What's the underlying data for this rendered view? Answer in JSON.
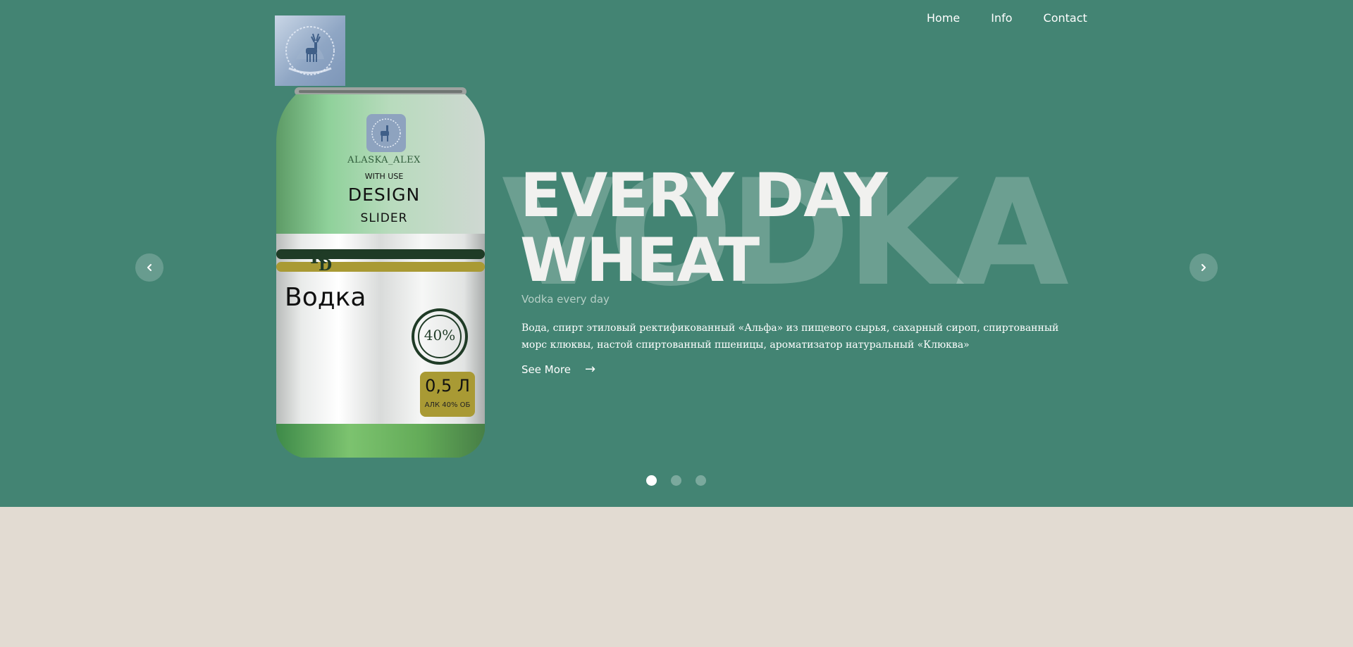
{
  "nav": {
    "items": [
      {
        "label": "Home"
      },
      {
        "label": "Info"
      },
      {
        "label": "Contact"
      }
    ]
  },
  "logo": {
    "alt": "ALASKA ALEX"
  },
  "can": {
    "brand": "ALASKA_ALEX",
    "with_use": "WITH USE",
    "design": "DESIGN",
    "slider": "SLIDER",
    "mark": "KD",
    "product": "Водка",
    "strength": "40%",
    "volume": "0,5 Л",
    "alc": "АЛК 40% ОБ"
  },
  "hero": {
    "watermark": "VODKA",
    "headline_line1": "EVERY DAY",
    "headline_line2": "WHEAT",
    "subtitle": "Vodka every day",
    "description": "Вода, спирт этиловый ректификованный «Альфа» из пищевого сырья, сахарный сироп, спиртованный морс клюквы, настой спиртованный пшеницы, ароматизатор натуральный «Клюква»",
    "see_more": "See More",
    "see_more_arrow": "→"
  },
  "slider": {
    "slides": 3,
    "active": 0
  },
  "colors": {
    "hero_bg": "#438473",
    "lower_bg": "#e2dbd2",
    "can_green": "#5fae6c",
    "can_stripe_dark": "#1f3b26",
    "can_stripe_gold": "#a99a34"
  },
  "icons": {
    "prev": "chevron-left-icon",
    "next": "chevron-right-icon",
    "logo": "deer-icon"
  }
}
